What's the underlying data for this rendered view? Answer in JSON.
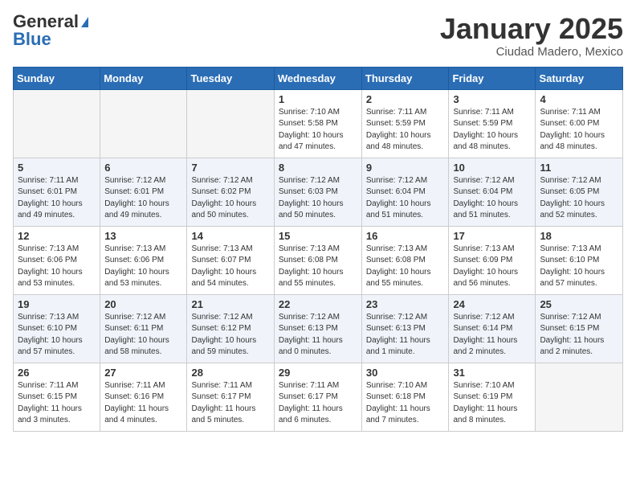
{
  "header": {
    "logo_general": "General",
    "logo_blue": "Blue",
    "month": "January 2025",
    "location": "Ciudad Madero, Mexico"
  },
  "weekdays": [
    "Sunday",
    "Monday",
    "Tuesday",
    "Wednesday",
    "Thursday",
    "Friday",
    "Saturday"
  ],
  "weeks": [
    [
      {
        "day": "",
        "info": ""
      },
      {
        "day": "",
        "info": ""
      },
      {
        "day": "",
        "info": ""
      },
      {
        "day": "1",
        "info": "Sunrise: 7:10 AM\nSunset: 5:58 PM\nDaylight: 10 hours\nand 47 minutes."
      },
      {
        "day": "2",
        "info": "Sunrise: 7:11 AM\nSunset: 5:59 PM\nDaylight: 10 hours\nand 48 minutes."
      },
      {
        "day": "3",
        "info": "Sunrise: 7:11 AM\nSunset: 5:59 PM\nDaylight: 10 hours\nand 48 minutes."
      },
      {
        "day": "4",
        "info": "Sunrise: 7:11 AM\nSunset: 6:00 PM\nDaylight: 10 hours\nand 48 minutes."
      }
    ],
    [
      {
        "day": "5",
        "info": "Sunrise: 7:11 AM\nSunset: 6:01 PM\nDaylight: 10 hours\nand 49 minutes."
      },
      {
        "day": "6",
        "info": "Sunrise: 7:12 AM\nSunset: 6:01 PM\nDaylight: 10 hours\nand 49 minutes."
      },
      {
        "day": "7",
        "info": "Sunrise: 7:12 AM\nSunset: 6:02 PM\nDaylight: 10 hours\nand 50 minutes."
      },
      {
        "day": "8",
        "info": "Sunrise: 7:12 AM\nSunset: 6:03 PM\nDaylight: 10 hours\nand 50 minutes."
      },
      {
        "day": "9",
        "info": "Sunrise: 7:12 AM\nSunset: 6:04 PM\nDaylight: 10 hours\nand 51 minutes."
      },
      {
        "day": "10",
        "info": "Sunrise: 7:12 AM\nSunset: 6:04 PM\nDaylight: 10 hours\nand 51 minutes."
      },
      {
        "day": "11",
        "info": "Sunrise: 7:12 AM\nSunset: 6:05 PM\nDaylight: 10 hours\nand 52 minutes."
      }
    ],
    [
      {
        "day": "12",
        "info": "Sunrise: 7:13 AM\nSunset: 6:06 PM\nDaylight: 10 hours\nand 53 minutes."
      },
      {
        "day": "13",
        "info": "Sunrise: 7:13 AM\nSunset: 6:06 PM\nDaylight: 10 hours\nand 53 minutes."
      },
      {
        "day": "14",
        "info": "Sunrise: 7:13 AM\nSunset: 6:07 PM\nDaylight: 10 hours\nand 54 minutes."
      },
      {
        "day": "15",
        "info": "Sunrise: 7:13 AM\nSunset: 6:08 PM\nDaylight: 10 hours\nand 55 minutes."
      },
      {
        "day": "16",
        "info": "Sunrise: 7:13 AM\nSunset: 6:08 PM\nDaylight: 10 hours\nand 55 minutes."
      },
      {
        "day": "17",
        "info": "Sunrise: 7:13 AM\nSunset: 6:09 PM\nDaylight: 10 hours\nand 56 minutes."
      },
      {
        "day": "18",
        "info": "Sunrise: 7:13 AM\nSunset: 6:10 PM\nDaylight: 10 hours\nand 57 minutes."
      }
    ],
    [
      {
        "day": "19",
        "info": "Sunrise: 7:13 AM\nSunset: 6:10 PM\nDaylight: 10 hours\nand 57 minutes."
      },
      {
        "day": "20",
        "info": "Sunrise: 7:12 AM\nSunset: 6:11 PM\nDaylight: 10 hours\nand 58 minutes."
      },
      {
        "day": "21",
        "info": "Sunrise: 7:12 AM\nSunset: 6:12 PM\nDaylight: 10 hours\nand 59 minutes."
      },
      {
        "day": "22",
        "info": "Sunrise: 7:12 AM\nSunset: 6:13 PM\nDaylight: 11 hours\nand 0 minutes."
      },
      {
        "day": "23",
        "info": "Sunrise: 7:12 AM\nSunset: 6:13 PM\nDaylight: 11 hours\nand 1 minute."
      },
      {
        "day": "24",
        "info": "Sunrise: 7:12 AM\nSunset: 6:14 PM\nDaylight: 11 hours\nand 2 minutes."
      },
      {
        "day": "25",
        "info": "Sunrise: 7:12 AM\nSunset: 6:15 PM\nDaylight: 11 hours\nand 2 minutes."
      }
    ],
    [
      {
        "day": "26",
        "info": "Sunrise: 7:11 AM\nSunset: 6:15 PM\nDaylight: 11 hours\nand 3 minutes."
      },
      {
        "day": "27",
        "info": "Sunrise: 7:11 AM\nSunset: 6:16 PM\nDaylight: 11 hours\nand 4 minutes."
      },
      {
        "day": "28",
        "info": "Sunrise: 7:11 AM\nSunset: 6:17 PM\nDaylight: 11 hours\nand 5 minutes."
      },
      {
        "day": "29",
        "info": "Sunrise: 7:11 AM\nSunset: 6:17 PM\nDaylight: 11 hours\nand 6 minutes."
      },
      {
        "day": "30",
        "info": "Sunrise: 7:10 AM\nSunset: 6:18 PM\nDaylight: 11 hours\nand 7 minutes."
      },
      {
        "day": "31",
        "info": "Sunrise: 7:10 AM\nSunset: 6:19 PM\nDaylight: 11 hours\nand 8 minutes."
      },
      {
        "day": "",
        "info": ""
      }
    ]
  ]
}
